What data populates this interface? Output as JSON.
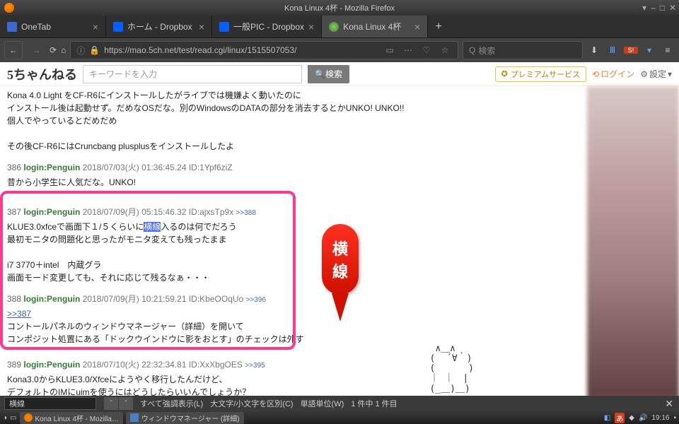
{
  "window": {
    "title": "Kona Linux 4杯 - Mozilla Firefox"
  },
  "tabs": [
    {
      "label": "OneTab",
      "active": false
    },
    {
      "label": "ホーム - Dropbox",
      "active": false
    },
    {
      "label": "一般PIC - Dropbox",
      "active": false
    },
    {
      "label": "Kona Linux 4杯",
      "active": true
    }
  ],
  "url": "https://mao.5ch.net/test/read.cgi/linux/1515507053/",
  "urlSearchPlaceholder": "検索",
  "site": {
    "logo": "5ちゃんねる",
    "searchPlaceholder": "キーワードを入力",
    "searchButton": "検索",
    "premium": "プレミアムサービス",
    "login": "ログイン",
    "settings": "設定"
  },
  "posts": [
    {
      "num": "",
      "name": "",
      "date": "",
      "id": "",
      "ref": "",
      "body": "Kona 4.0 Light をCF-R6にインストールしたがライブでは機嫌よく動いたのに\nインストール後は起動せず。だめなOSだな。別のWindowsのDATAの部分を消去するとかUNKO! UNKO!!\n個人でやっているとだめだめ\n\nその後CF-R6にはCruncbang plusplusをインストールしたよ"
    },
    {
      "num": "386",
      "name": "login:Penguin",
      "date": "2018/07/03(火) 01:36:45.24",
      "id": "ID:1Ypf6ziZ",
      "ref": "",
      "body": "昔から小学生に人気だな。UNKO!"
    },
    {
      "num": "387",
      "name": "login:Penguin",
      "date": "2018/07/09(月) 05:15:46.32",
      "id": "ID:ajxsTp9x",
      "ref": ">>388",
      "body_pre": "KLUE3.0xfceで画面下１/５くらいに",
      "body_hl": "横線",
      "body_post": "入るのは何でだろう\n最初モニタの問題化と思ったがモニタ変えても残ったまま\n\ni7 3770＋intel　内蔵グラ\n画面モード変更しても、それに応じて残るなぁ・・・"
    },
    {
      "num": "388",
      "name": "login:Penguin",
      "date": "2018/07/09(月) 10:21:59.21",
      "id": "ID:KbeOOqUo",
      "ref": ">>396",
      "link": ">>387",
      "body": "コントールパネルのウィンドウマネージャー（詳細）を開いて\nコンポジット処置にある「ドックウインドウに影をおとす」のチェックは外す"
    },
    {
      "num": "389",
      "name": "login:Penguin",
      "date": "2018/07/10(火) 22:32:34.81",
      "id": "ID:XxXbgOES",
      "ref": ">>395",
      "body": "Kona3.0からKLUE3.0/Xfceにようやく移行したんだけど、\nデフォルトのIMにuimを使うにはどうしたらいいんでしょうか？"
    }
  ],
  "callout": {
    "c1": "横",
    "c2": "線"
  },
  "aa": " ∧＿∧\n(  ´∀｀)\n(　　　 )\n｜ ｜　|\n(_＿)＿)",
  "findbar": {
    "value": "横線",
    "highlightAll": "すべて強調表示(L)",
    "matchCase": "大文字/小文字を区別(C)",
    "wholeWord": "単語単位(W)",
    "result": "1 件中 1 件目"
  },
  "taskbar": {
    "tasks": [
      "Kona Linux 4杯 - Mozilla…",
      "ウィンドウマネージャー (詳細)"
    ],
    "time": "19:16"
  }
}
